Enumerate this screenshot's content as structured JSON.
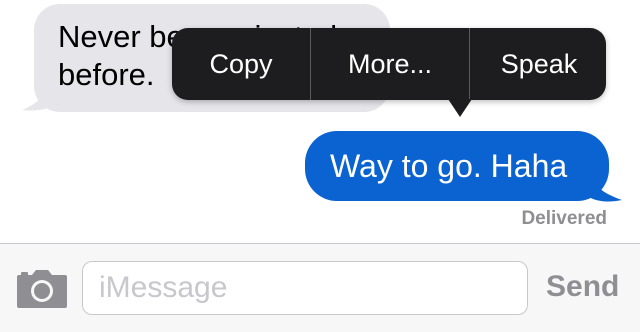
{
  "conversation": {
    "incoming_message": "Never been rejected\nbefore.",
    "outgoing_message": "Way to go. Haha",
    "delivery_status": "Delivered"
  },
  "context_menu": {
    "items": [
      {
        "label": "Copy"
      },
      {
        "label": "More..."
      },
      {
        "label": "Speak"
      }
    ]
  },
  "composer": {
    "placeholder": "iMessage",
    "value": "",
    "send_label": "Send",
    "camera_icon": "camera-icon"
  },
  "colors": {
    "outgoing_bubble": "#0a63d1",
    "incoming_bubble": "#e5e5ea",
    "menu_background": "#1d1d1f",
    "muted_text": "#8e8e93"
  }
}
